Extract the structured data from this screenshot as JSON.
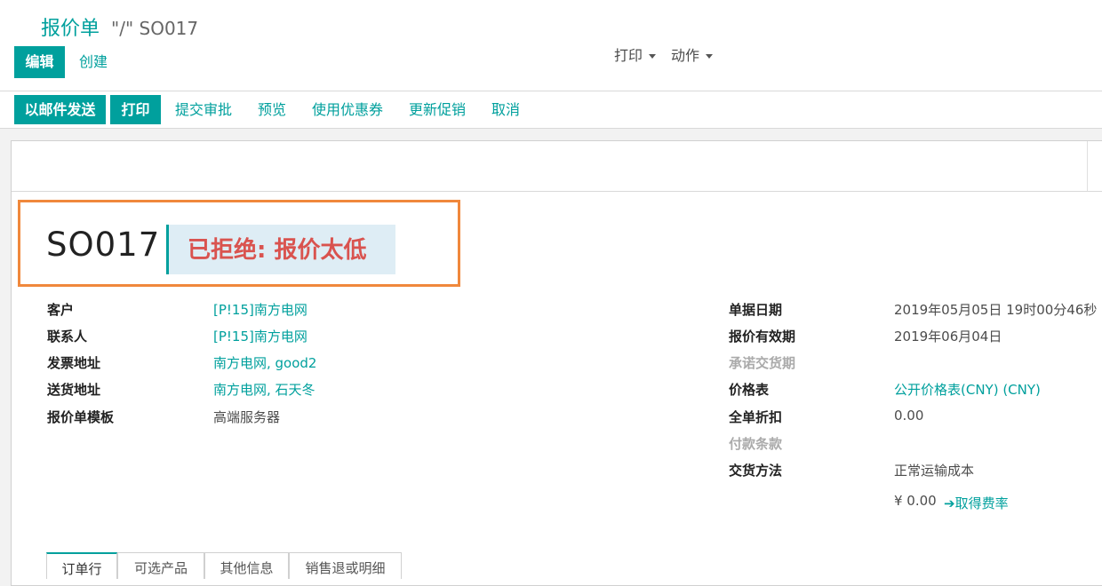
{
  "breadcrumb": {
    "parent": "报价单",
    "current": "\"/\" SO017"
  },
  "control": {
    "edit_label": "编辑",
    "create_label": "创建",
    "print_dropdown": "打印",
    "action_dropdown": "动作"
  },
  "statusbar": {
    "send_email": "以邮件发送",
    "print": "打印",
    "submit_approval": "提交审批",
    "preview": "预览",
    "use_coupon": "使用优惠券",
    "update_promotions": "更新促销",
    "cancel": "取消"
  },
  "record": {
    "name": "SO017",
    "state_ribbon": "已拒绝: 报价太低"
  },
  "left_fields": [
    {
      "label": "客户",
      "value": "[P!15]南方电网"
    },
    {
      "label": "联系人",
      "value": "[P!15]南方电网"
    },
    {
      "label": "发票地址",
      "value": "南方电网, good2"
    },
    {
      "label": "送货地址",
      "value": "南方电网, 石天冬"
    },
    {
      "label": "报价单模板",
      "value": "高端服务器"
    }
  ],
  "right_fields": [
    {
      "label": "单据日期",
      "value": "2019年05月05日 19时00分46秒"
    },
    {
      "label": "报价有效期",
      "value": "2019年06月04日"
    },
    {
      "label": "承诺交货期",
      "value": ""
    },
    {
      "label": "价格表",
      "value": "公开价格表(CNY) (CNY)"
    },
    {
      "label": "全单折扣",
      "value": "0.00"
    },
    {
      "label": "付款条款",
      "value": ""
    },
    {
      "label": "交货方法",
      "value": "正常运输成本"
    }
  ],
  "shipping": {
    "amount": "¥ 0.00",
    "get_rate": "取得费率"
  },
  "tabs": [
    "订单行",
    "可选产品",
    "其他信息",
    "销售退或明细"
  ],
  "colors": {
    "accent": "#00a09d",
    "danger": "#d9534f",
    "highlight": "#f0883c"
  }
}
